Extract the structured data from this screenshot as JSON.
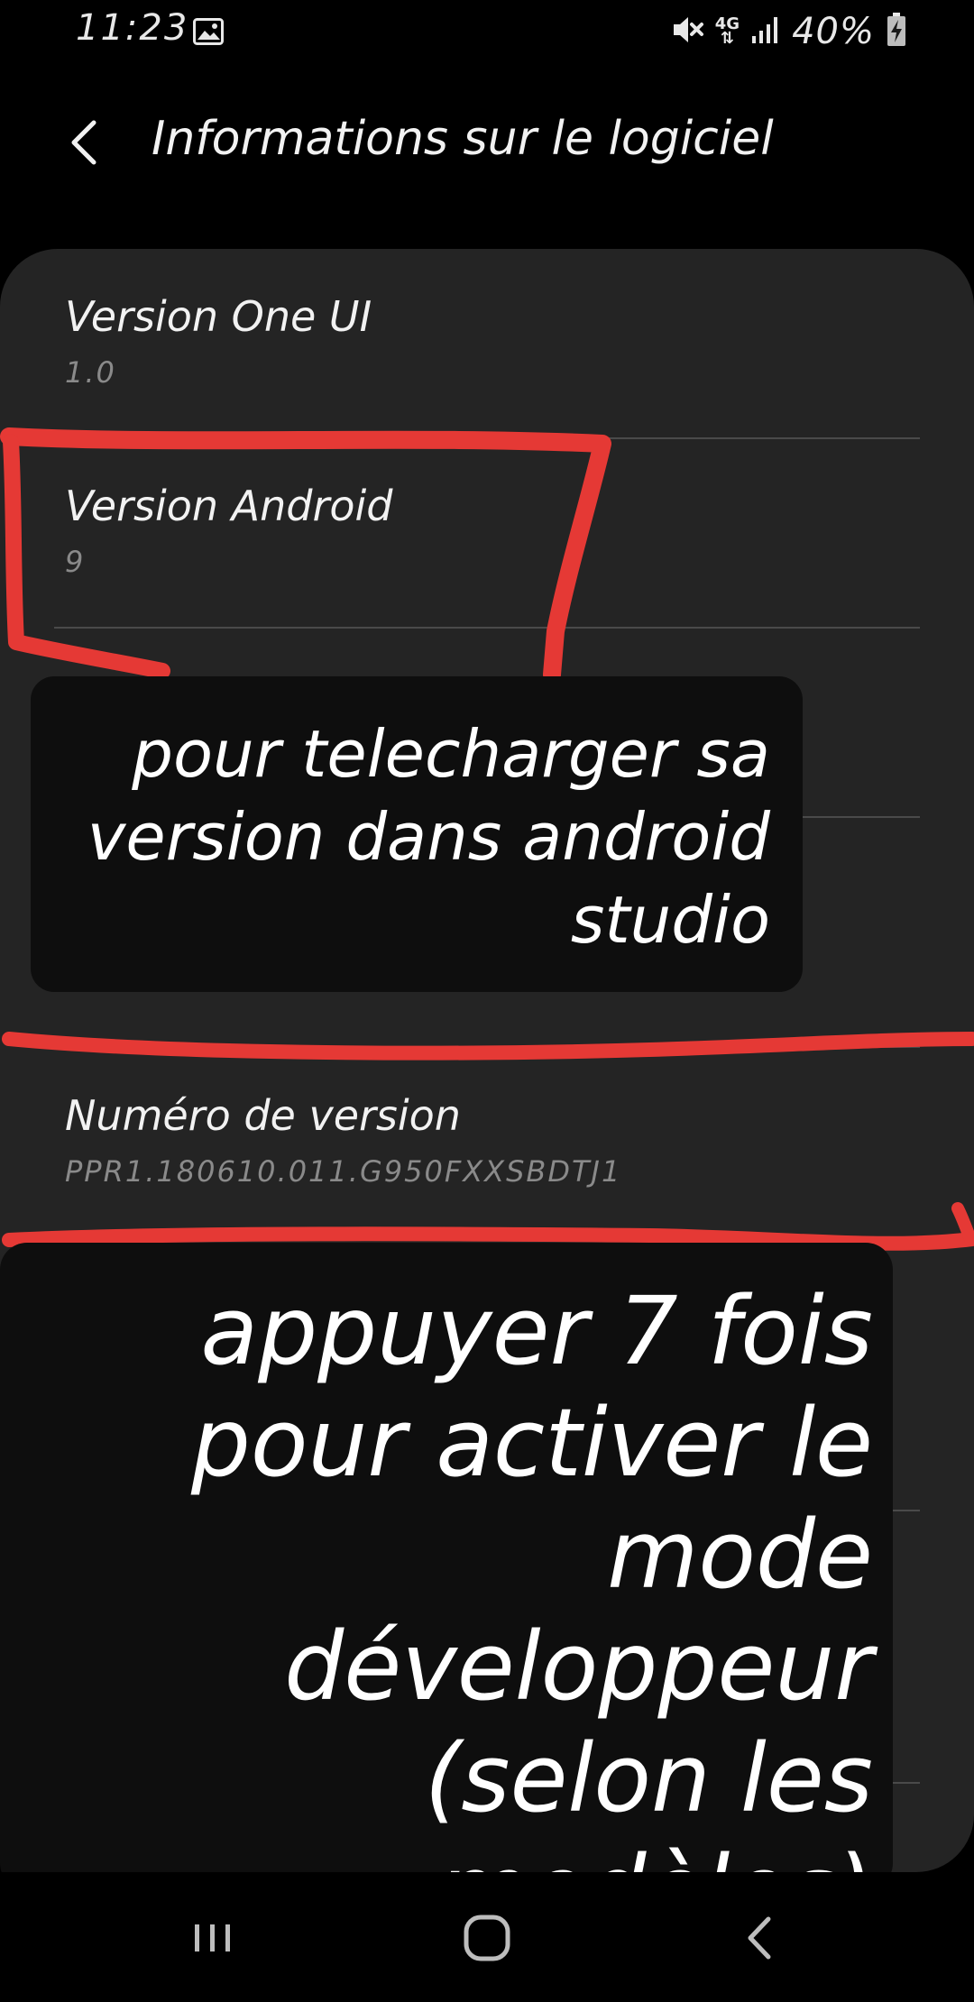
{
  "status_bar": {
    "time": "11:23",
    "gallery_icon": "gallery-icon",
    "network_label": "4G",
    "battery_text": "40%"
  },
  "app_bar": {
    "title": "Informations sur le logiciel",
    "back_icon": "back-arrow-icon"
  },
  "rows": [
    {
      "title": "Version One UI",
      "value": "1.0"
    },
    {
      "title": "Version Android",
      "value": "9"
    },
    {
      "title": "",
      "value": ""
    },
    {
      "title": "",
      "value": ""
    },
    {
      "title": "Numéro de version",
      "value": "PPR1.180610.011.G950FXXSBDTJ1"
    }
  ],
  "annotations": {
    "note_top": [
      "pour telecharger sa",
      "version dans android",
      "studio"
    ],
    "note_bottom": [
      "appuyer 7 fois",
      "pour activer le",
      "mode développeur",
      "(selon les",
      "modèles)"
    ]
  },
  "markup_color": "#e53935",
  "nav_bar": {
    "recents_icon": "recents-icon",
    "home_icon": "home-icon",
    "back_icon": "back-icon"
  }
}
